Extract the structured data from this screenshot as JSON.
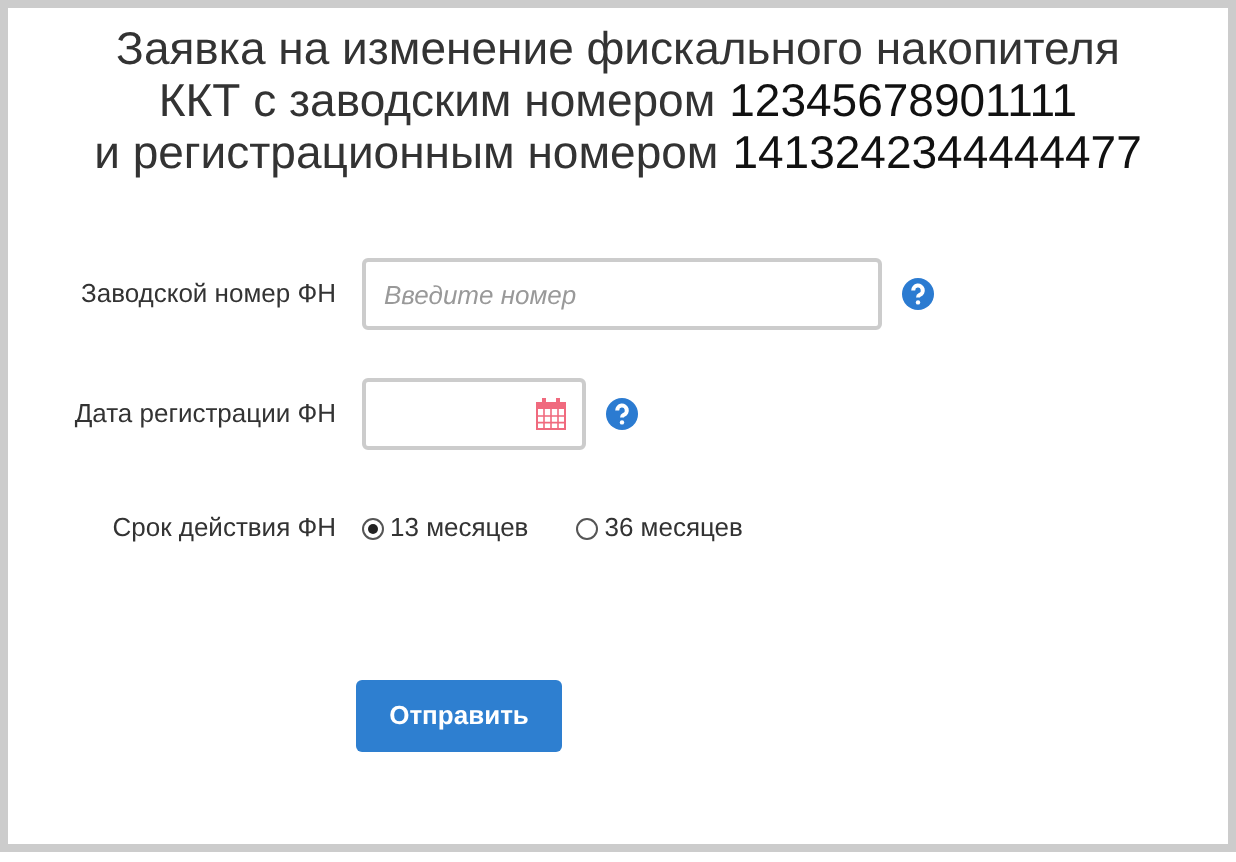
{
  "title_lines": [
    {
      "text": "Заявка на изменение фискального накопителя"
    },
    {
      "text": "ККТ с заводским номером",
      "number": "12345678901111"
    },
    {
      "text": "и регистрационным номером",
      "number": "1413242344444477"
    }
  ],
  "serial_field": {
    "label": "Заводской номер ФН",
    "placeholder": "Введите номер"
  },
  "date_field": {
    "label": "Дата регистрации ФН"
  },
  "validity": {
    "label": "Срок действия ФН",
    "options": [
      {
        "label": "13 месяцев",
        "selected": true
      },
      {
        "label": "36 месяцев",
        "selected": false
      }
    ]
  },
  "submit_button": "Отправить"
}
